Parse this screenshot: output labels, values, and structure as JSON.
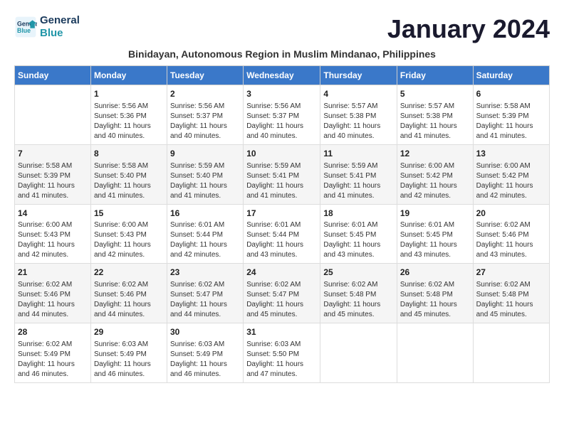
{
  "header": {
    "logo_line1": "General",
    "logo_line2": "Blue",
    "month_title": "January 2024",
    "subtitle": "Binidayan, Autonomous Region in Muslim Mindanao, Philippines"
  },
  "weekdays": [
    "Sunday",
    "Monday",
    "Tuesday",
    "Wednesday",
    "Thursday",
    "Friday",
    "Saturday"
  ],
  "weeks": [
    [
      {
        "day": "",
        "info": ""
      },
      {
        "day": "1",
        "info": "Sunrise: 5:56 AM\nSunset: 5:36 PM\nDaylight: 11 hours\nand 40 minutes."
      },
      {
        "day": "2",
        "info": "Sunrise: 5:56 AM\nSunset: 5:37 PM\nDaylight: 11 hours\nand 40 minutes."
      },
      {
        "day": "3",
        "info": "Sunrise: 5:56 AM\nSunset: 5:37 PM\nDaylight: 11 hours\nand 40 minutes."
      },
      {
        "day": "4",
        "info": "Sunrise: 5:57 AM\nSunset: 5:38 PM\nDaylight: 11 hours\nand 40 minutes."
      },
      {
        "day": "5",
        "info": "Sunrise: 5:57 AM\nSunset: 5:38 PM\nDaylight: 11 hours\nand 41 minutes."
      },
      {
        "day": "6",
        "info": "Sunrise: 5:58 AM\nSunset: 5:39 PM\nDaylight: 11 hours\nand 41 minutes."
      }
    ],
    [
      {
        "day": "7",
        "info": "Sunrise: 5:58 AM\nSunset: 5:39 PM\nDaylight: 11 hours\nand 41 minutes."
      },
      {
        "day": "8",
        "info": "Sunrise: 5:58 AM\nSunset: 5:40 PM\nDaylight: 11 hours\nand 41 minutes."
      },
      {
        "day": "9",
        "info": "Sunrise: 5:59 AM\nSunset: 5:40 PM\nDaylight: 11 hours\nand 41 minutes."
      },
      {
        "day": "10",
        "info": "Sunrise: 5:59 AM\nSunset: 5:41 PM\nDaylight: 11 hours\nand 41 minutes."
      },
      {
        "day": "11",
        "info": "Sunrise: 5:59 AM\nSunset: 5:41 PM\nDaylight: 11 hours\nand 41 minutes."
      },
      {
        "day": "12",
        "info": "Sunrise: 6:00 AM\nSunset: 5:42 PM\nDaylight: 11 hours\nand 42 minutes."
      },
      {
        "day": "13",
        "info": "Sunrise: 6:00 AM\nSunset: 5:42 PM\nDaylight: 11 hours\nand 42 minutes."
      }
    ],
    [
      {
        "day": "14",
        "info": "Sunrise: 6:00 AM\nSunset: 5:43 PM\nDaylight: 11 hours\nand 42 minutes."
      },
      {
        "day": "15",
        "info": "Sunrise: 6:00 AM\nSunset: 5:43 PM\nDaylight: 11 hours\nand 42 minutes."
      },
      {
        "day": "16",
        "info": "Sunrise: 6:01 AM\nSunset: 5:44 PM\nDaylight: 11 hours\nand 42 minutes."
      },
      {
        "day": "17",
        "info": "Sunrise: 6:01 AM\nSunset: 5:44 PM\nDaylight: 11 hours\nand 43 minutes."
      },
      {
        "day": "18",
        "info": "Sunrise: 6:01 AM\nSunset: 5:45 PM\nDaylight: 11 hours\nand 43 minutes."
      },
      {
        "day": "19",
        "info": "Sunrise: 6:01 AM\nSunset: 5:45 PM\nDaylight: 11 hours\nand 43 minutes."
      },
      {
        "day": "20",
        "info": "Sunrise: 6:02 AM\nSunset: 5:46 PM\nDaylight: 11 hours\nand 43 minutes."
      }
    ],
    [
      {
        "day": "21",
        "info": "Sunrise: 6:02 AM\nSunset: 5:46 PM\nDaylight: 11 hours\nand 44 minutes."
      },
      {
        "day": "22",
        "info": "Sunrise: 6:02 AM\nSunset: 5:46 PM\nDaylight: 11 hours\nand 44 minutes."
      },
      {
        "day": "23",
        "info": "Sunrise: 6:02 AM\nSunset: 5:47 PM\nDaylight: 11 hours\nand 44 minutes."
      },
      {
        "day": "24",
        "info": "Sunrise: 6:02 AM\nSunset: 5:47 PM\nDaylight: 11 hours\nand 45 minutes."
      },
      {
        "day": "25",
        "info": "Sunrise: 6:02 AM\nSunset: 5:48 PM\nDaylight: 11 hours\nand 45 minutes."
      },
      {
        "day": "26",
        "info": "Sunrise: 6:02 AM\nSunset: 5:48 PM\nDaylight: 11 hours\nand 45 minutes."
      },
      {
        "day": "27",
        "info": "Sunrise: 6:02 AM\nSunset: 5:48 PM\nDaylight: 11 hours\nand 45 minutes."
      }
    ],
    [
      {
        "day": "28",
        "info": "Sunrise: 6:02 AM\nSunset: 5:49 PM\nDaylight: 11 hours\nand 46 minutes."
      },
      {
        "day": "29",
        "info": "Sunrise: 6:03 AM\nSunset: 5:49 PM\nDaylight: 11 hours\nand 46 minutes."
      },
      {
        "day": "30",
        "info": "Sunrise: 6:03 AM\nSunset: 5:49 PM\nDaylight: 11 hours\nand 46 minutes."
      },
      {
        "day": "31",
        "info": "Sunrise: 6:03 AM\nSunset: 5:50 PM\nDaylight: 11 hours\nand 47 minutes."
      },
      {
        "day": "",
        "info": ""
      },
      {
        "day": "",
        "info": ""
      },
      {
        "day": "",
        "info": ""
      }
    ]
  ]
}
